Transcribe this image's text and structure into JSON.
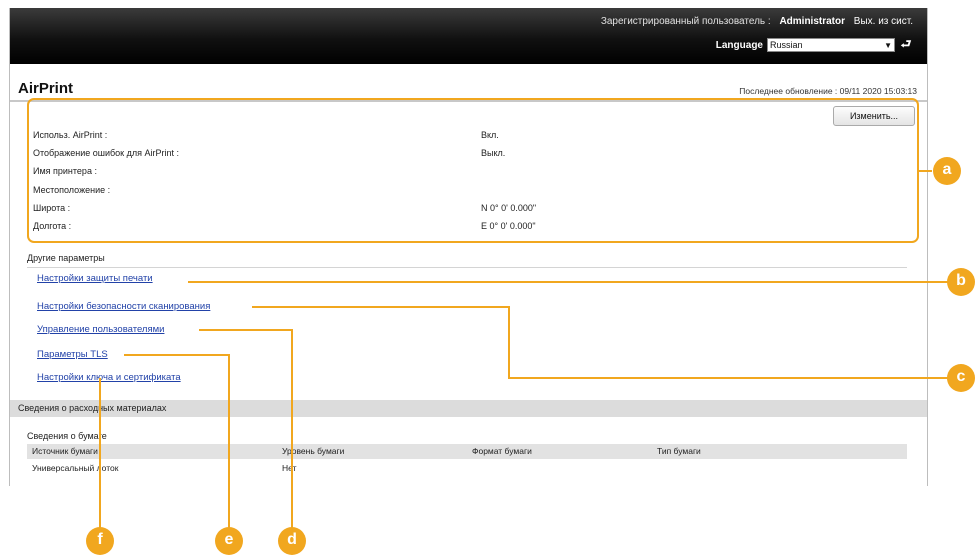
{
  "header": {
    "user_label": "Зарегистрированный пользователь :",
    "user_name": "Administrator",
    "logout_label": "Вых. из сист.",
    "language_label": "Language",
    "language_value": "Russian"
  },
  "page": {
    "title": "AirPrint",
    "last_update": "Последнее обновление : 09/11 2020 15:03:13",
    "edit_button": "Изменить..."
  },
  "settings": [
    {
      "label": "Использ. AirPrint :",
      "value": "Вкл."
    },
    {
      "label": "Отображение ошибок для AirPrint :",
      "value": "Выкл."
    },
    {
      "label": "Имя принтера :",
      "value": ""
    },
    {
      "label": "Местоположение :",
      "value": ""
    },
    {
      "label": "Широта :",
      "value": "N 0° 0' 0.000\""
    },
    {
      "label": "Долгота :",
      "value": "E 0° 0' 0.000\""
    }
  ],
  "other": {
    "heading": "Другие параметры",
    "links": [
      "Настройки защиты печати",
      "Настройки безопасности сканирования",
      "Управление пользователями",
      "Параметры TLS",
      "Настройки ключа и сертификата"
    ]
  },
  "supplies": {
    "heading": "Сведения о расходных материалах",
    "paper_heading": "Сведения о бумаге",
    "columns": [
      "Источник бумаги",
      "Уровень бумаги",
      "Формат бумаги",
      "Тип бумаги"
    ],
    "rows": [
      [
        "Универсальный лоток",
        "Нет",
        "",
        ""
      ]
    ]
  },
  "callouts": [
    "a",
    "b",
    "c",
    "d",
    "e",
    "f"
  ],
  "colors": {
    "callout": "#f1a71f",
    "link": "#2242a8",
    "header_bg": "#000000"
  }
}
